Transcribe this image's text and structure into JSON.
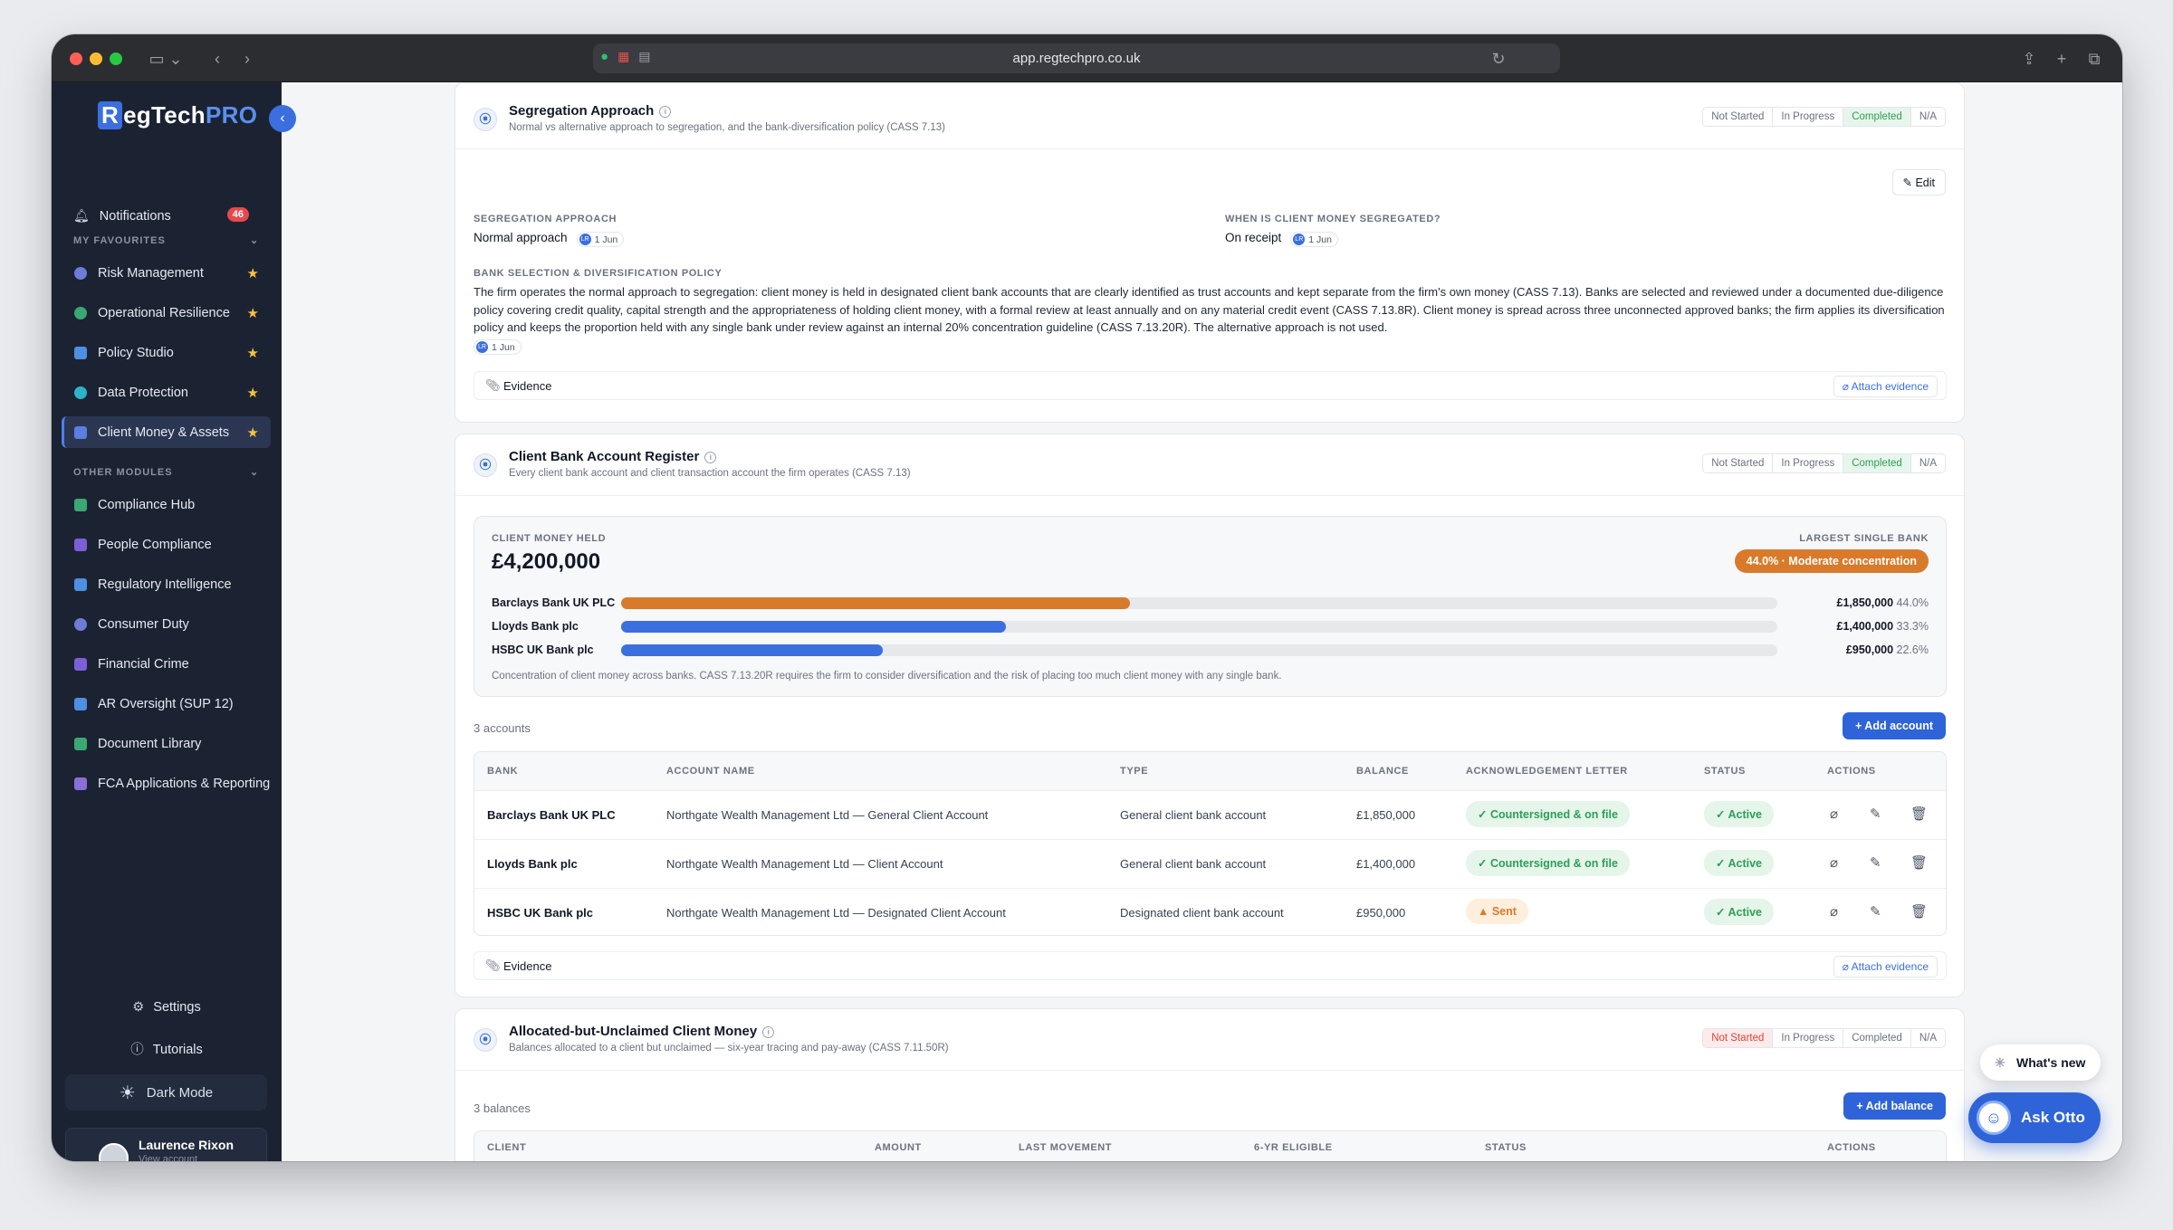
{
  "browser": {
    "url": "app.regtechpro.co.uk"
  },
  "brand": {
    "first_letter": "R",
    "name_rest": "egTech",
    "name_suffix": "PRO"
  },
  "sidebar": {
    "notifications": {
      "label": "Notifications",
      "count": "46"
    },
    "favourites_title": "MY FAVOURITES",
    "favourites": [
      {
        "label": "Risk Management",
        "color": "#6b7dd8"
      },
      {
        "label": "Operational Resilience",
        "color": "#3aa872"
      },
      {
        "label": "Policy Studio",
        "color": "#4d8fe0"
      },
      {
        "label": "Data Protection",
        "color": "#2bb3c9"
      },
      {
        "label": "Client Money & Assets",
        "color": "#5b7fe0"
      }
    ],
    "other_title": "OTHER MODULES",
    "others": [
      {
        "label": "Compliance Hub",
        "color": "#3aa872"
      },
      {
        "label": "People Compliance",
        "color": "#7c5fd8"
      },
      {
        "label": "Regulatory Intelligence",
        "color": "#4d8fe0"
      },
      {
        "label": "Consumer Duty",
        "color": "#6b7dd8"
      },
      {
        "label": "Financial Crime",
        "color": "#7c5fd8"
      },
      {
        "label": "AR Oversight (SUP 12)",
        "color": "#4d8fe0"
      },
      {
        "label": "Document Library",
        "color": "#3aa872"
      },
      {
        "label": "FCA Applications & Reporting",
        "color": "#8b6fd8"
      }
    ],
    "settings": "Settings",
    "tutorials": "Tutorials",
    "dark_mode": "Dark Mode",
    "user": {
      "name": "Laurence Rixon",
      "sub": "View account"
    }
  },
  "status_options": [
    "Not Started",
    "In Progress",
    "Completed",
    "N/A"
  ],
  "segregation": {
    "title": "Segregation Approach",
    "subtitle": "Normal vs alternative approach to segregation, and the bank-diversification policy (CASS 7.13)",
    "status": "Completed",
    "edit": "Edit",
    "approach_label": "SEGREGATION APPROACH",
    "approach_value": "Normal approach",
    "when_label": "WHEN IS CLIENT MONEY SEGREGATED?",
    "when_value": "On receipt",
    "date_tag": "1 Jun",
    "avatar_initials": "LR",
    "policy_label": "BANK SELECTION & DIVERSIFICATION POLICY",
    "policy_text": "The firm operates the normal approach to segregation: client money is held in designated client bank accounts that are clearly identified as trust accounts and kept separate from the firm's own money (CASS 7.13). Banks are selected and reviewed under a documented due-diligence policy covering credit quality, capital strength and the appropriateness of holding client money, with a formal review at least annually and on any material credit event (CASS 7.13.8R). Client money is spread across three unconnected approved banks; the firm applies its diversification policy and keeps the proportion held with any single bank under review against an internal 20% concentration guideline (CASS 7.13.20R). The alternative approach is not used.",
    "evidence": "Evidence",
    "attach": "Attach evidence"
  },
  "register": {
    "title": "Client Bank Account Register",
    "subtitle": "Every client bank account and client transaction account the firm operates (CASS 7.13)",
    "status": "Completed",
    "held_label": "CLIENT MONEY HELD",
    "held_value": "£4,200,000",
    "largest_label": "LARGEST SINGLE BANK",
    "largest_value": "44.0% · Moderate concentration",
    "banks": [
      {
        "name": "Barclays Bank UK PLC",
        "amount": "£1,850,000",
        "pct": "44.0%",
        "share": 0.44,
        "color": "#d97a2b"
      },
      {
        "name": "Lloyds Bank plc",
        "amount": "£1,400,000",
        "pct": "33.3%",
        "share": 0.333,
        "color": "#3b6fe0"
      },
      {
        "name": "HSBC UK Bank plc",
        "amount": "£950,000",
        "pct": "22.6%",
        "share": 0.226,
        "color": "#3b6fe0"
      }
    ],
    "note": "Concentration of client money across banks. CASS 7.13.20R requires the firm to consider diversification and the risk of placing too much client money with any single bank.",
    "count": "3 accounts",
    "add": "Add account",
    "columns": [
      "BANK",
      "ACCOUNT NAME",
      "TYPE",
      "BALANCE",
      "ACKNOWLEDGEMENT LETTER",
      "STATUS",
      "ACTIONS"
    ],
    "rows": [
      {
        "bank": "Barclays Bank UK PLC",
        "account": "Northgate Wealth Management Ltd — General Client Account",
        "type": "General client bank account",
        "balance": "£1,850,000",
        "ack": "✓ Countersigned & on file",
        "ack_kind": "g",
        "status": "✓ Active"
      },
      {
        "bank": "Lloyds Bank plc",
        "account": "Northgate Wealth Management Ltd — Client Account",
        "type": "General client bank account",
        "balance": "£1,400,000",
        "ack": "✓ Countersigned & on file",
        "ack_kind": "g",
        "status": "✓ Active"
      },
      {
        "bank": "HSBC UK Bank plc",
        "account": "Northgate Wealth Management Ltd — Designated Client Account",
        "type": "Designated client bank account",
        "balance": "£950,000",
        "ack": "▲ Sent",
        "ack_kind": "o",
        "status": "✓ Active"
      }
    ],
    "evidence": "Evidence",
    "attach": "Attach evidence"
  },
  "unclaimed": {
    "title": "Allocated-but-Unclaimed Client Money",
    "subtitle": "Balances allocated to a client but unclaimed — six-year tracing and pay-away (CASS 7.11.50R)",
    "status": "Not Started",
    "count": "3 balances",
    "add": "Add balance",
    "columns": [
      "CLIENT",
      "AMOUNT",
      "LAST MOVEMENT",
      "6-YR ELIGIBLE",
      "STATUS",
      "ACTIONS"
    ]
  },
  "floating": {
    "whats_new": "What's new",
    "ask_otto": "Ask Otto"
  }
}
